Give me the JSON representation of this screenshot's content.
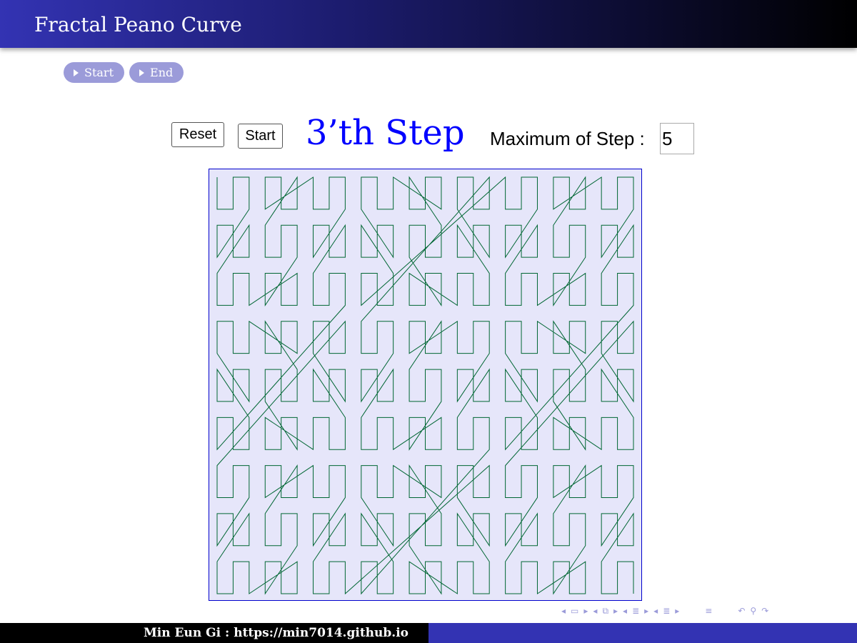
{
  "slide": {
    "title": "Fractal Peano Curve"
  },
  "nav_buttons": [
    {
      "label": "Start"
    },
    {
      "label": "End"
    }
  ],
  "controls": {
    "reset_label": "Reset",
    "start_label": "Start",
    "step_text": "3’th Step",
    "max_label": "Maximum of Step :",
    "max_value": "5"
  },
  "canvas": {
    "background": "#e6e6fa",
    "border_color": "#0000cc",
    "curve_color": "#006633",
    "peano_order": 3
  },
  "nav_symbols": {
    "icons": [
      "arrow-left-icon",
      "frame-icon",
      "arrow-right-icon",
      "arrow-left-icon",
      "subsection-icon",
      "arrow-right-icon",
      "arrow-left-icon",
      "section-icon",
      "arrow-right-icon",
      "arrow-left-icon",
      "section-icon",
      "arrow-right-icon",
      "align-icon",
      "zoom-back-icon",
      "search-icon",
      "zoom-forward-icon"
    ]
  },
  "footer": {
    "author": "Min Eun Gi : https://min7014.github.io"
  },
  "colors": {
    "title_bar_start": "#3333b3",
    "title_bar_end": "#000000",
    "button_bg": "#9b9bd9",
    "step_color": "#0000ff",
    "footer_right": "#3333b3"
  }
}
